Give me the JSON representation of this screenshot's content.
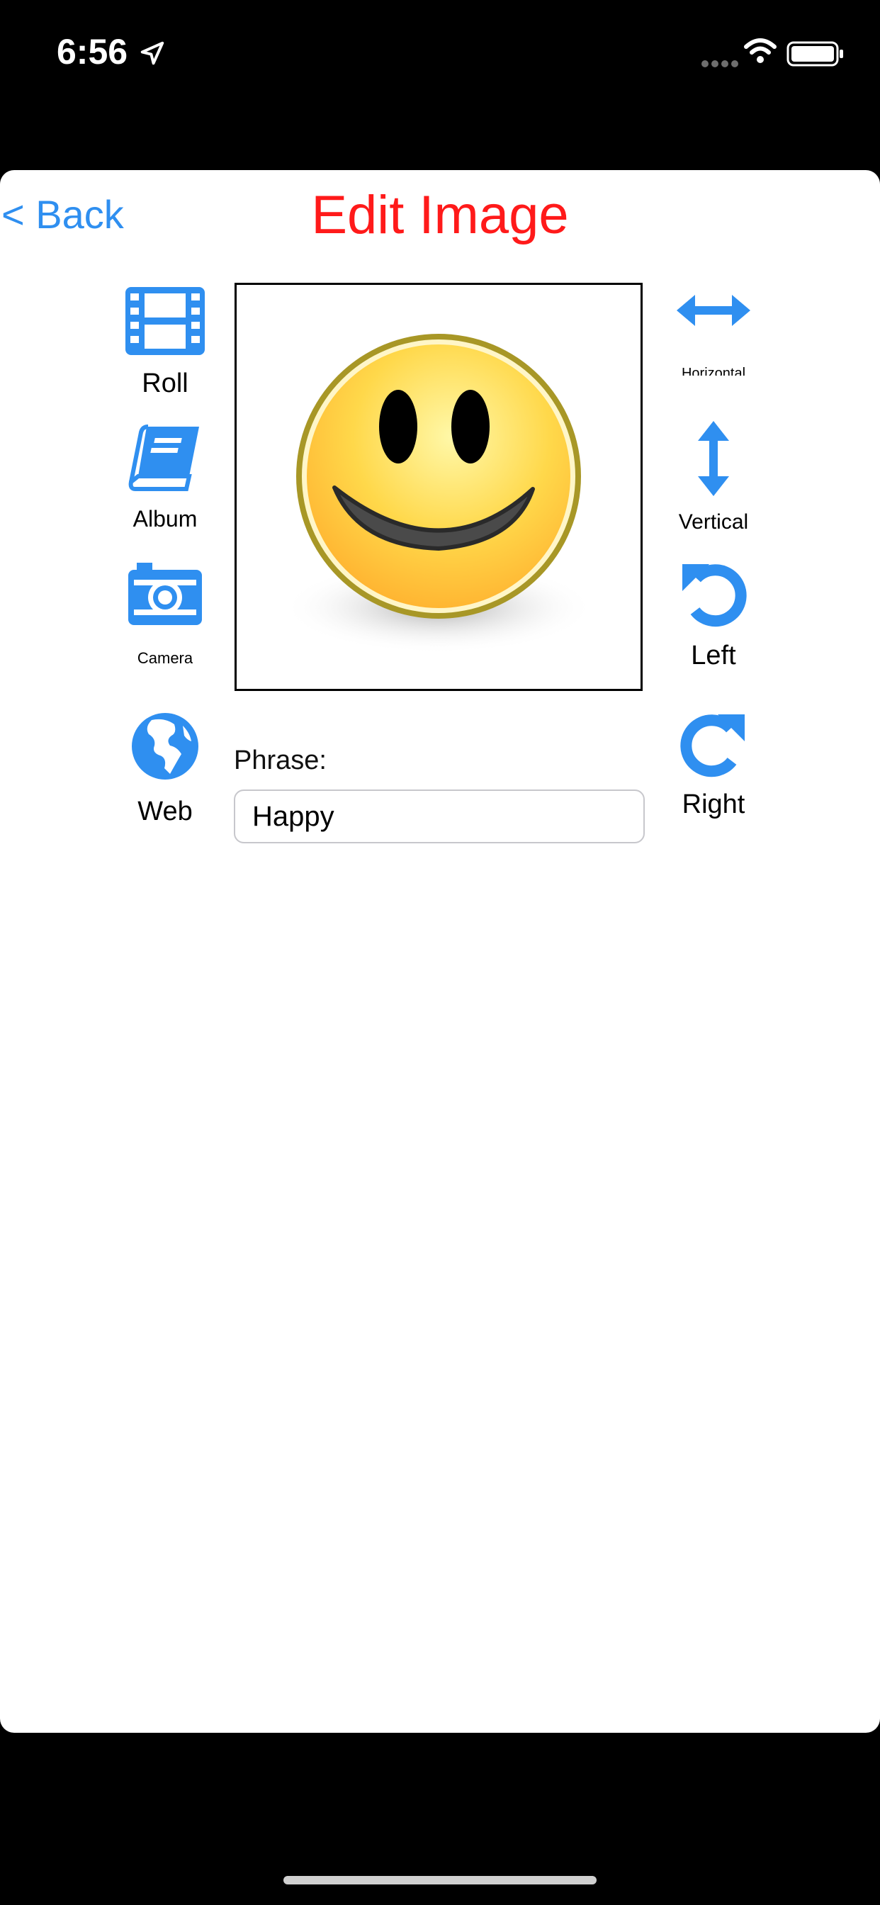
{
  "status_bar": {
    "time": "6:56",
    "icons": [
      "location-arrow-icon",
      "signal-icon",
      "wifi-icon",
      "battery-icon"
    ]
  },
  "nav": {
    "back_label": "< Back",
    "title": "Edit Image"
  },
  "colors": {
    "accent": "#2f8ff0",
    "title": "#ff1a1a",
    "background": "#000000",
    "card": "#ffffff"
  },
  "left_tools": [
    {
      "label": "Roll",
      "icon": "film-icon"
    },
    {
      "label": "Album",
      "icon": "book-icon"
    },
    {
      "label": "Camera",
      "icon": "camera-icon"
    },
    {
      "label": "Web",
      "icon": "globe-icon"
    }
  ],
  "right_tools": [
    {
      "label": "Horizontal",
      "icon": "horizontal-arrows-icon"
    },
    {
      "label": "Vertical",
      "icon": "vertical-arrows-icon"
    },
    {
      "label": "Left",
      "icon": "rotate-left-icon"
    },
    {
      "label": "Right",
      "icon": "rotate-right-icon"
    }
  ],
  "image": {
    "content": "smiley-face-icon"
  },
  "phrase": {
    "label": "Phrase:",
    "value": "Happy"
  }
}
